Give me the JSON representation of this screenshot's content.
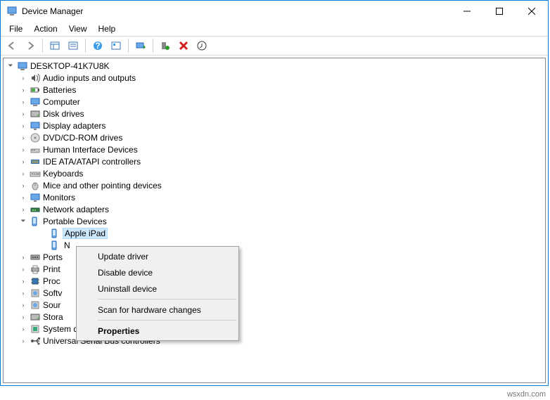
{
  "window": {
    "title": "Device Manager"
  },
  "menu": {
    "file": "File",
    "action": "Action",
    "view": "View",
    "help": "Help"
  },
  "tree": {
    "root": "DESKTOP-41K7U8K",
    "items": [
      {
        "label": "Audio inputs and outputs"
      },
      {
        "label": "Batteries"
      },
      {
        "label": "Computer"
      },
      {
        "label": "Disk drives"
      },
      {
        "label": "Display adapters"
      },
      {
        "label": "DVD/CD-ROM drives"
      },
      {
        "label": "Human Interface Devices"
      },
      {
        "label": "IDE ATA/ATAPI controllers"
      },
      {
        "label": "Keyboards"
      },
      {
        "label": "Mice and other pointing devices"
      },
      {
        "label": "Monitors"
      },
      {
        "label": "Network adapters"
      },
      {
        "label": "Portable Devices",
        "expanded": true,
        "children": [
          {
            "label": "Apple iPad"
          },
          {
            "label": "N"
          }
        ]
      },
      {
        "label": "Ports"
      },
      {
        "label": "Print"
      },
      {
        "label": "Proc"
      },
      {
        "label": "Softv"
      },
      {
        "label": "Sour"
      },
      {
        "label": "Stora"
      },
      {
        "label": "System devices"
      },
      {
        "label": "Universal Serial Bus controllers"
      }
    ]
  },
  "contextMenu": {
    "update": "Update driver",
    "disable": "Disable device",
    "uninstall": "Uninstall device",
    "scan": "Scan for hardware changes",
    "properties": "Properties"
  },
  "watermark": "wsxdn.com"
}
